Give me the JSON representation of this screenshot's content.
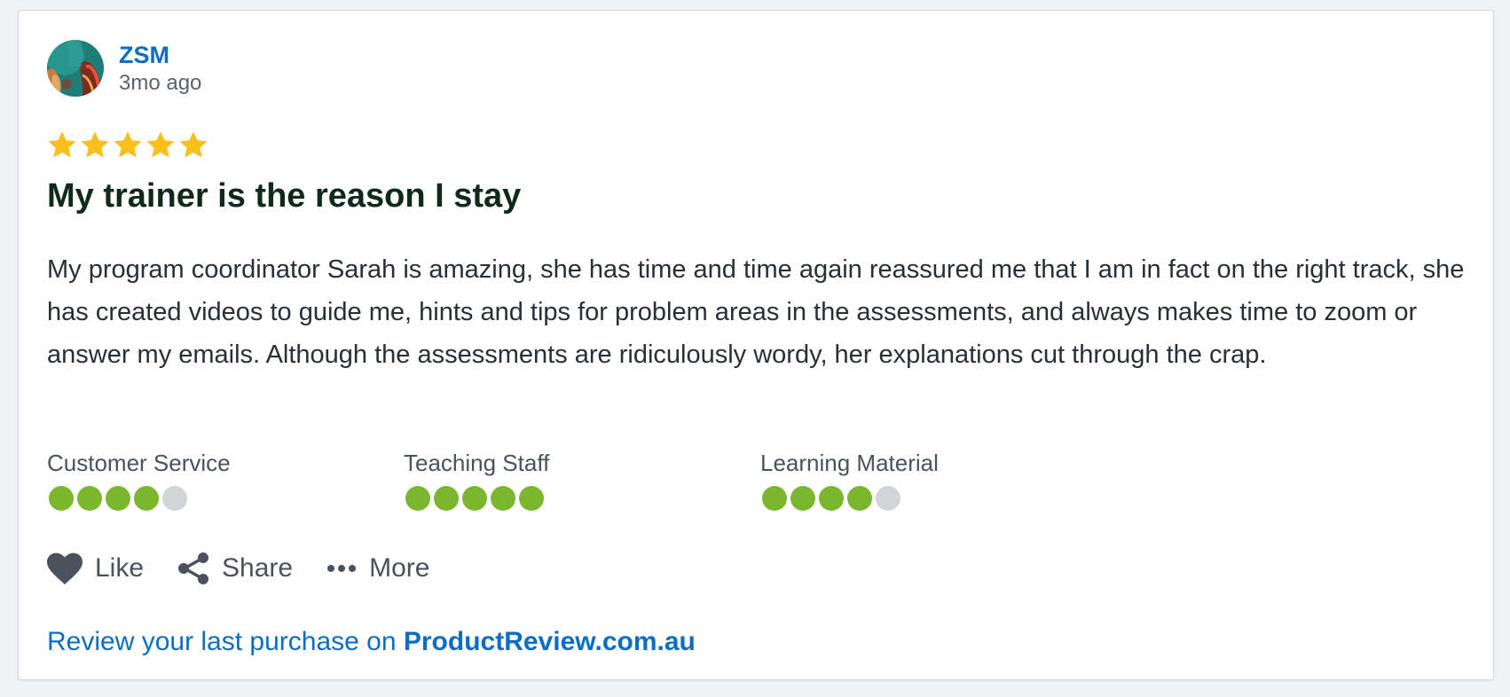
{
  "review": {
    "author": "ZSM",
    "timestamp": "3mo ago",
    "rating": 5,
    "title": "My trainer is the reason I stay",
    "body": "My program coordinator Sarah is amazing, she has time and time again reassured me that I am in fact on the right track, she has created videos to guide me, hints and tips for problem areas in the assessments, and always makes time to zoom or answer my emails. Although the assessments are ridiculously wordy, her explanations cut through the crap."
  },
  "ratings": [
    {
      "label": "Customer Service",
      "score": 4,
      "max": 5
    },
    {
      "label": "Teaching Staff",
      "score": 5,
      "max": 5
    },
    {
      "label": "Learning Material",
      "score": 4,
      "max": 5
    }
  ],
  "actions": {
    "like": "Like",
    "share": "Share",
    "more": "More"
  },
  "footer": {
    "prefix": "Review your last purchase on ",
    "brand": "ProductReview.com.au"
  },
  "colors": {
    "star": "#fbbf1b",
    "rating_filled": "#7ab72e",
    "rating_empty": "#d2d4d8",
    "link": "#0a6ec4",
    "title": "#0f2a1c"
  },
  "icons": [
    "avatar-image",
    "star-icon",
    "heart-icon",
    "share-icon",
    "more-dots-icon"
  ]
}
